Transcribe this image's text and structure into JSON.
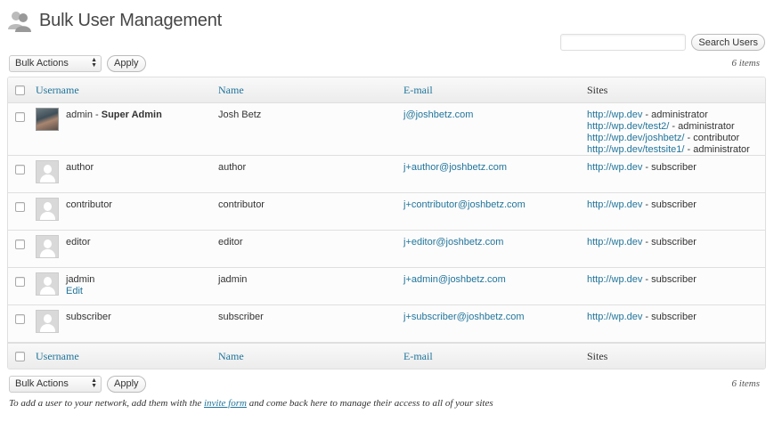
{
  "page": {
    "title": "Bulk User Management"
  },
  "search": {
    "placeholder": "",
    "button_label": "Search Users"
  },
  "tablenav": {
    "bulk_actions_label": "Bulk Actions",
    "apply_label": "Apply",
    "item_count": "6 items"
  },
  "columns": {
    "username": "Username",
    "name": "Name",
    "email": "E-mail",
    "sites": "Sites"
  },
  "users": [
    {
      "username": "admin",
      "role_suffix": "Super Admin",
      "separator": " - ",
      "name": "Josh Betz",
      "email": "j@joshbetz.com",
      "avatar": "photo",
      "sites": [
        {
          "url": "http://wp.dev",
          "role": "administrator"
        },
        {
          "url": "http://wp.dev/test2/",
          "role": "administrator"
        },
        {
          "url": "http://wp.dev/joshbetz/",
          "role": "contributor"
        },
        {
          "url": "http://wp.dev/testsite1/",
          "role": "administrator"
        }
      ]
    },
    {
      "username": "author",
      "name": "author",
      "email": "j+author@joshbetz.com",
      "avatar": "generic",
      "sites": [
        {
          "url": "http://wp.dev",
          "role": "subscriber"
        }
      ]
    },
    {
      "username": "contributor",
      "name": "contributor",
      "email": "j+contributor@joshbetz.com",
      "avatar": "generic",
      "sites": [
        {
          "url": "http://wp.dev",
          "role": "subscriber"
        }
      ]
    },
    {
      "username": "editor",
      "name": "editor",
      "email": "j+editor@joshbetz.com",
      "avatar": "generic",
      "sites": [
        {
          "url": "http://wp.dev",
          "role": "subscriber"
        }
      ]
    },
    {
      "username": "jadmin",
      "row_action": "Edit",
      "name": "jadmin",
      "email": "j+admin@joshbetz.com",
      "avatar": "generic",
      "sites": [
        {
          "url": "http://wp.dev",
          "role": "subscriber"
        }
      ]
    },
    {
      "username": "subscriber",
      "name": "subscriber",
      "email": "j+subscriber@joshbetz.com",
      "avatar": "generic",
      "sites": [
        {
          "url": "http://wp.dev",
          "role": "subscriber"
        }
      ]
    }
  ],
  "footnote": {
    "before": "To add a user to your network, add them with the ",
    "link": "invite form",
    "after": " and come back here to manage their access to all of your sites"
  },
  "colors": {
    "link": "#21759b",
    "text": "#333333",
    "header_bg": "#f1f1f1"
  },
  "icons": {
    "page_icon": "users-icon",
    "select_arrows": "updown-arrows-icon"
  }
}
